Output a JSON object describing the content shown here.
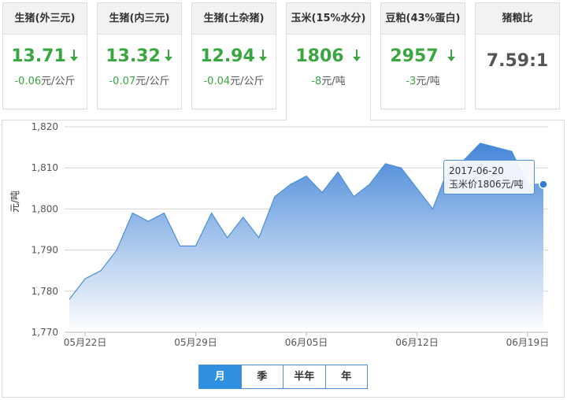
{
  "cards": [
    {
      "title": "生猪(外三元)",
      "value": "13.71",
      "change": "-0.06",
      "unit": "元/公斤",
      "trend": "down-arrow"
    },
    {
      "title": "生猪(内三元)",
      "value": "13.32",
      "change": "-0.07",
      "unit": "元/公斤",
      "trend": "down-arrow"
    },
    {
      "title": "生猪(土杂猪)",
      "value": "12.94",
      "change": "-0.04",
      "unit": "元/公斤",
      "trend": "down-arrow"
    },
    {
      "title": "玉米(15%水分)",
      "value": "1806",
      "change": "-8",
      "unit": "元/吨",
      "trend": "down-arrow",
      "active": true
    },
    {
      "title": "豆粕(43%蛋白)",
      "value": "2957",
      "change": "-3",
      "unit": "元/吨",
      "trend": "down-arrow"
    },
    {
      "title": "猪粮比",
      "value": "7.59:1"
    }
  ],
  "colors": {
    "down": "#3aa640",
    "accent": "#2f8fe0",
    "area_top": "#3a7fd5",
    "area_bottom": "#ffffff"
  },
  "tooltip": {
    "date": "2017-06-20",
    "label": "玉米价1806元/吨"
  },
  "periods": [
    "月",
    "季",
    "半年",
    "年"
  ],
  "active_period": "月",
  "chart_data": {
    "type": "area",
    "ylabel": "元/吨",
    "ylim": [
      1770,
      1820
    ],
    "yticks": [
      1770,
      1780,
      1790,
      1800,
      1810,
      1820
    ],
    "ytick_labels": [
      "1,770",
      "1,780",
      "1,790",
      "1,800",
      "1,810",
      "1,820"
    ],
    "grid": true,
    "x": [
      "2017-05-21",
      "2017-05-22",
      "2017-05-23",
      "2017-05-24",
      "2017-05-25",
      "2017-05-26",
      "2017-05-27",
      "2017-05-28",
      "2017-05-29",
      "2017-05-30",
      "2017-05-31",
      "2017-06-01",
      "2017-06-02",
      "2017-06-03",
      "2017-06-04",
      "2017-06-05",
      "2017-06-06",
      "2017-06-07",
      "2017-06-08",
      "2017-06-09",
      "2017-06-10",
      "2017-06-11",
      "2017-06-12",
      "2017-06-13",
      "2017-06-14",
      "2017-06-15",
      "2017-06-16",
      "2017-06-17",
      "2017-06-18",
      "2017-06-19",
      "2017-06-20"
    ],
    "xtick_labels": [
      "05月22日",
      "05月29日",
      "06月05日",
      "06月12日",
      "06月19日"
    ],
    "xtick_index": [
      1,
      8,
      15,
      22,
      29
    ],
    "series": [
      {
        "values": [
          1778,
          1783,
          1785,
          1790,
          1799,
          1797,
          1799,
          1791,
          1791,
          1799,
          1793,
          1798,
          1793,
          1803,
          1806,
          1808,
          1804,
          1809,
          1803,
          1806,
          1811,
          1810,
          1805,
          1800,
          1810,
          1812,
          1816,
          1815,
          1814,
          1806,
          1806
        ]
      }
    ]
  }
}
